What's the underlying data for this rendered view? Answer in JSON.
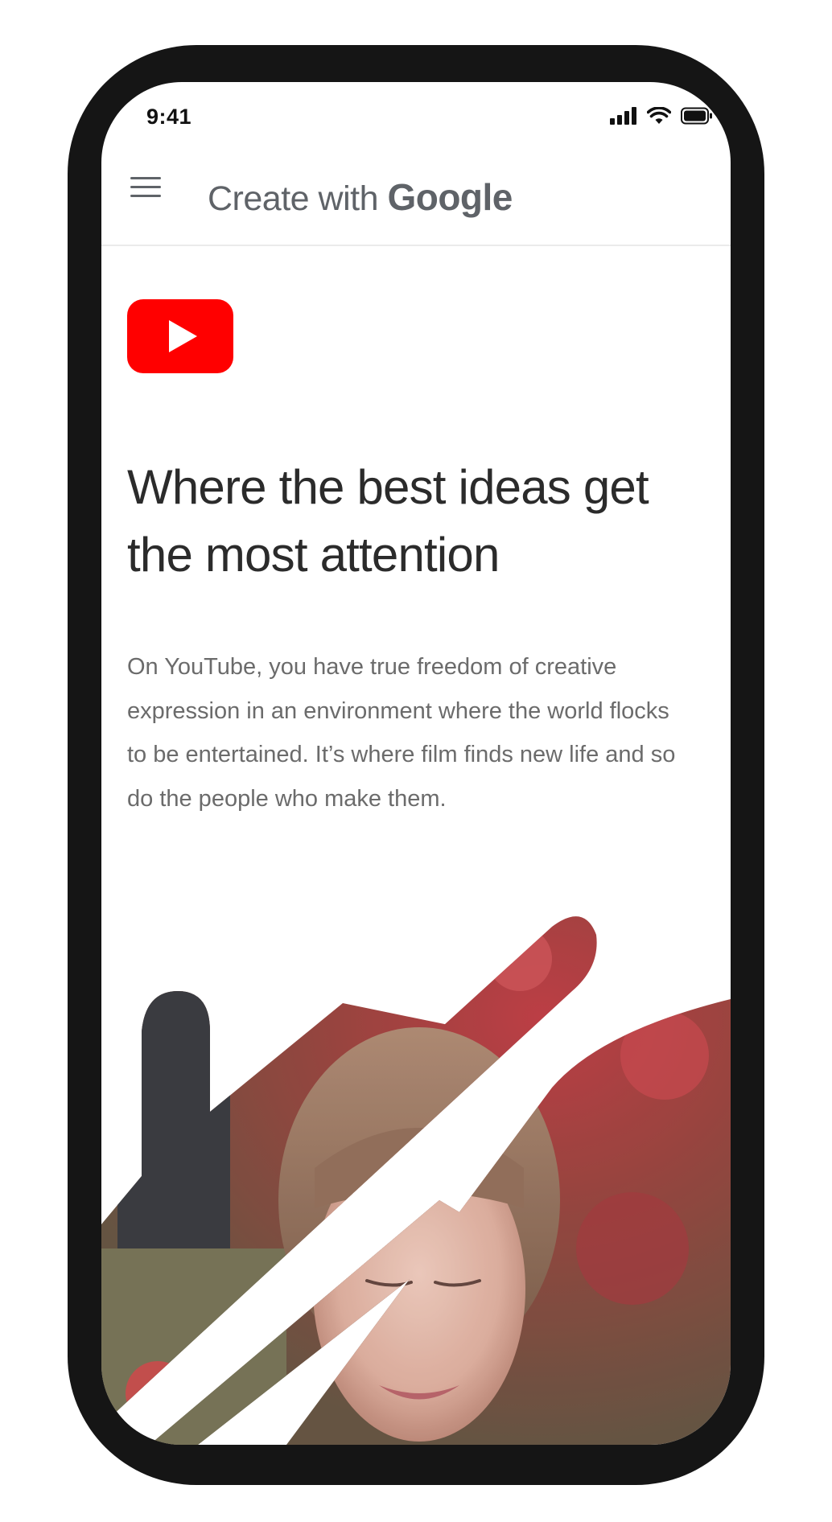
{
  "status_bar": {
    "time": "9:41",
    "icons": [
      "signal-icon",
      "wifi-icon",
      "battery-icon"
    ]
  },
  "header": {
    "menu_icon": "hamburger-menu-icon",
    "brand_prefix": "Create with ",
    "brand_strong": "Google"
  },
  "content": {
    "logo": "youtube-logo-icon",
    "headline": "Where the best ideas get the most attention",
    "body": "On YouTube, you have true freedom of creative expression in an environment where the world flocks to be entertained. It’s where film finds new life and so do the people who make them."
  },
  "colors": {
    "youtube_red": "#FF0000",
    "headline": "#2b2b2b",
    "body": "#6b6b6b",
    "brand": "#5f6368",
    "frame": "#151515"
  }
}
